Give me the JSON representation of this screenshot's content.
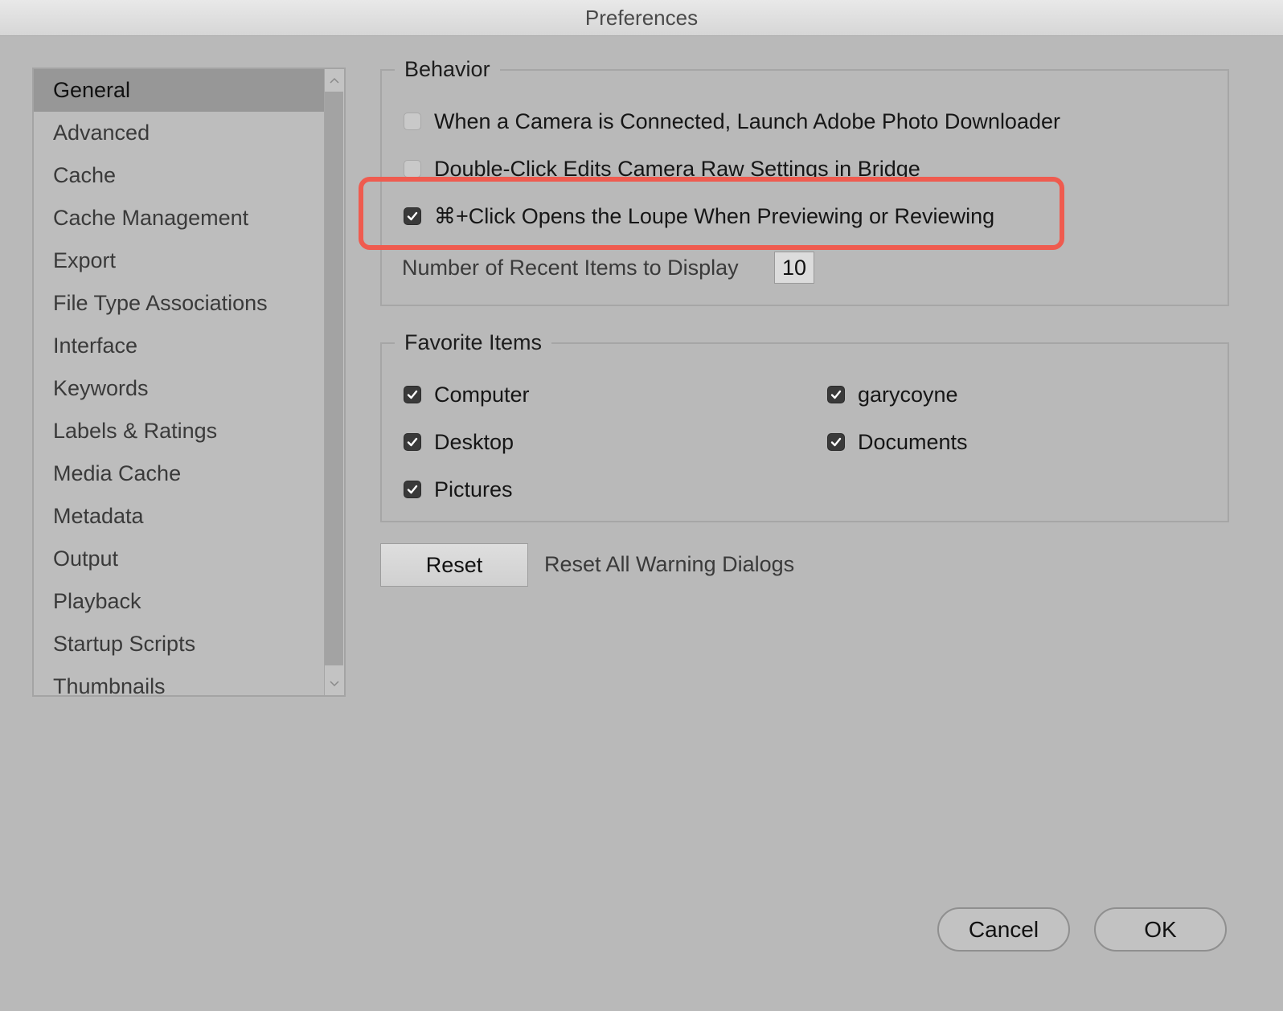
{
  "window": {
    "title": "Preferences"
  },
  "sidebar": {
    "items": [
      {
        "label": "General",
        "selected": true
      },
      {
        "label": "Advanced"
      },
      {
        "label": "Cache"
      },
      {
        "label": "Cache Management"
      },
      {
        "label": "Export"
      },
      {
        "label": "File Type Associations"
      },
      {
        "label": "Interface"
      },
      {
        "label": "Keywords"
      },
      {
        "label": "Labels & Ratings"
      },
      {
        "label": "Media Cache"
      },
      {
        "label": "Metadata"
      },
      {
        "label": "Output"
      },
      {
        "label": "Playback"
      },
      {
        "label": "Startup Scripts"
      },
      {
        "label": "Thumbnails"
      }
    ]
  },
  "behavior": {
    "title": "Behavior",
    "launch_downloader": {
      "label": "When a Camera is Connected, Launch Adobe Photo Downloader",
      "checked": false
    },
    "double_click_raw": {
      "label": "Double-Click Edits Camera Raw Settings in Bridge",
      "checked": false
    },
    "cmd_click_loupe": {
      "label": "⌘+Click Opens the Loupe When Previewing or Reviewing",
      "checked": true
    },
    "recent_items": {
      "label": "Number of Recent Items to Display",
      "value": "10"
    }
  },
  "favorites": {
    "title": "Favorite Items",
    "items": [
      {
        "label": "Computer",
        "checked": true
      },
      {
        "label": "garycoyne",
        "checked": true
      },
      {
        "label": "Desktop",
        "checked": true
      },
      {
        "label": "Documents",
        "checked": true
      },
      {
        "label": "Pictures",
        "checked": true
      }
    ]
  },
  "reset": {
    "button_label": "Reset",
    "description": "Reset All Warning Dialogs"
  },
  "footer": {
    "cancel_label": "Cancel",
    "ok_label": "OK"
  },
  "colors": {
    "highlight": "#ef5b4f",
    "selected_row": "#979797",
    "background": "#b9b9b9"
  },
  "icons": {
    "checkbox_checked": "checkmark-icon",
    "scroll_up": "chevron-up-icon",
    "scroll_down": "chevron-down-icon"
  }
}
